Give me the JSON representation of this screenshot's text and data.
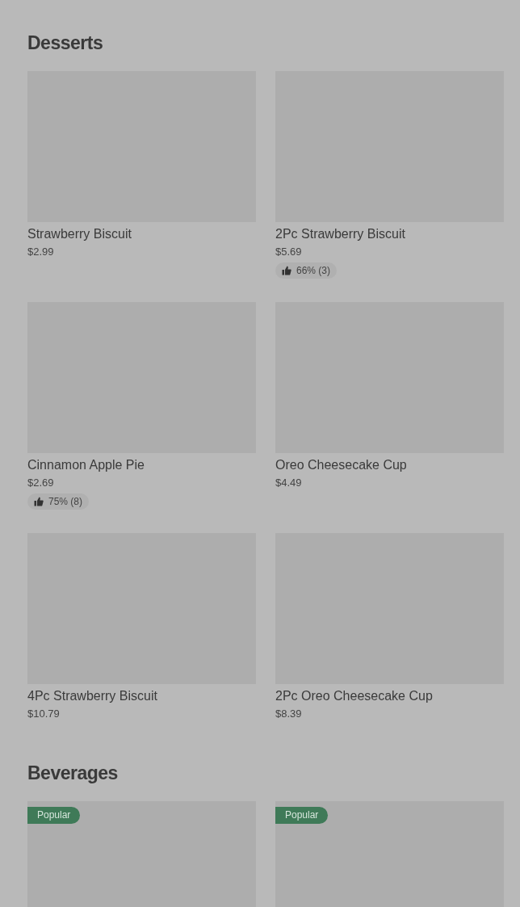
{
  "sections": [
    {
      "title": "Desserts",
      "items": [
        {
          "name": "Strawberry Biscuit",
          "price": "$2.99"
        },
        {
          "name": "2Pc Strawberry Biscuit",
          "price": "$5.69",
          "rating": "66% (3)"
        },
        {
          "name": "Cinnamon Apple Pie",
          "price": "$2.69",
          "rating": "75% (8)"
        },
        {
          "name": "Oreo Cheesecake Cup",
          "price": "$4.49"
        },
        {
          "name": "4Pc Strawberry Biscuit",
          "price": "$10.79"
        },
        {
          "name": "2Pc Oreo Cheesecake Cup",
          "price": "$8.39"
        }
      ]
    },
    {
      "title": "Beverages",
      "items": [
        {
          "badge": "Popular"
        },
        {
          "badge": "Popular"
        }
      ]
    }
  ]
}
